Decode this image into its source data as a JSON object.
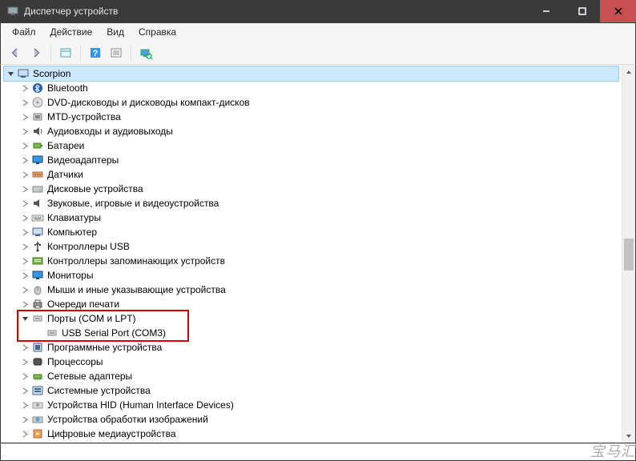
{
  "window": {
    "title": "Диспетчер устройств"
  },
  "menu": {
    "file": "Файл",
    "action": "Действие",
    "view": "Вид",
    "help": "Справка"
  },
  "root": {
    "label": "Scorpion"
  },
  "nodes": [
    {
      "label": "Bluetooth",
      "icon": "bluetooth"
    },
    {
      "label": "DVD-дисководы и дисководы компакт-дисков",
      "icon": "dvd"
    },
    {
      "label": "MTD-устройства",
      "icon": "mtd"
    },
    {
      "label": "Аудиовходы и аудиовыходы",
      "icon": "audio"
    },
    {
      "label": "Батареи",
      "icon": "battery"
    },
    {
      "label": "Видеоадаптеры",
      "icon": "display"
    },
    {
      "label": "Датчики",
      "icon": "sensor"
    },
    {
      "label": "Дисковые устройства",
      "icon": "disk"
    },
    {
      "label": "Звуковые, игровые и видеоустройства",
      "icon": "sound"
    },
    {
      "label": "Клавиатуры",
      "icon": "keyboard"
    },
    {
      "label": "Компьютер",
      "icon": "computer"
    },
    {
      "label": "Контроллеры USB",
      "icon": "usb"
    },
    {
      "label": "Контроллеры запоминающих устройств",
      "icon": "storage-ctrl"
    },
    {
      "label": "Мониторы",
      "icon": "monitor"
    },
    {
      "label": "Мыши и иные указывающие устройства",
      "icon": "mouse"
    },
    {
      "label": "Очереди печати",
      "icon": "printer"
    }
  ],
  "ports": {
    "group_label": "Порты (COM и LPT)",
    "child_label": "USB Serial Port (COM3)"
  },
  "nodes_after": [
    {
      "label": "Программные устройства",
      "icon": "software"
    },
    {
      "label": "Процессоры",
      "icon": "cpu"
    },
    {
      "label": "Сетевые адаптеры",
      "icon": "network"
    },
    {
      "label": "Системные устройства",
      "icon": "system"
    },
    {
      "label": "Устройства HID (Human Interface Devices)",
      "icon": "hid"
    },
    {
      "label": "Устройства обработки изображений",
      "icon": "imaging"
    },
    {
      "label": "Цифровые медиаустройства",
      "icon": "media"
    }
  ],
  "watermark": "宝马汇"
}
